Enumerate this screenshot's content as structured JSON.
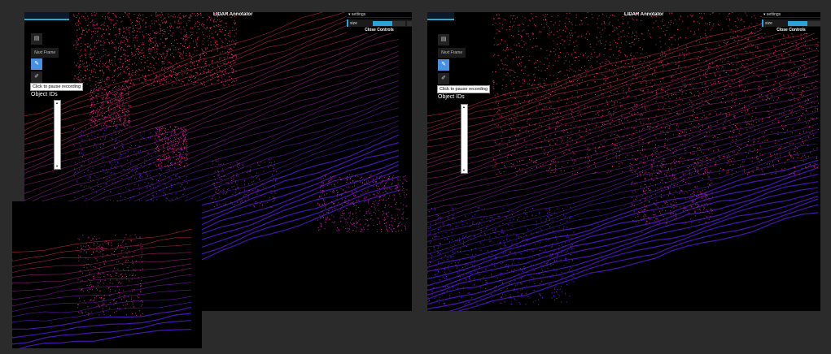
{
  "app": {
    "title": "LIDAR Annotator"
  },
  "gui": {
    "header": "▾ settings",
    "param_label": "size",
    "param_level": 0.6,
    "close_label": "Close Controls"
  },
  "toolbar": {
    "next_frame_label": "Next Frame",
    "tooltip": "Click to pause recording",
    "object_ids_label": "Object IDs"
  },
  "colors": {
    "background": "#2b2b2b",
    "accent": "#2fa1d6",
    "active_tool": "#4a90e2",
    "points_near": "#6a1bff",
    "points_far": "#ff2a5a"
  },
  "icons": [
    "file-icon",
    "pencil-icon",
    "edit-icon",
    "scroll-up-icon",
    "scroll-down-icon"
  ]
}
